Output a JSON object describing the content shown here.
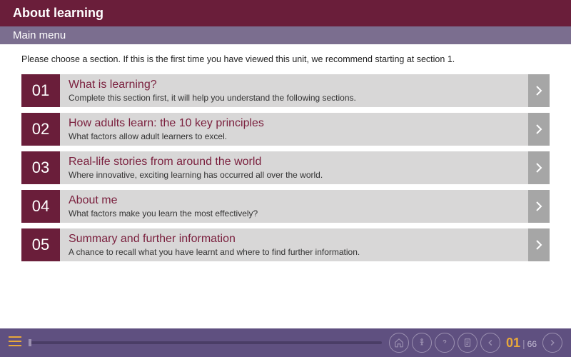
{
  "header": {
    "title": "About learning",
    "subtitle": "Main menu"
  },
  "instruction": "Please choose a section. If this is the first time you have viewed this unit, we recommend starting at section 1.",
  "sections": [
    {
      "num": "01",
      "title": "What is learning?",
      "desc": "Complete this section first, it will help you understand the following sections."
    },
    {
      "num": "02",
      "title": "How adults learn: the 10 key principles",
      "desc": "What factors allow adult learners to excel."
    },
    {
      "num": "03",
      "title": "Real-life stories from around the world",
      "desc": "Where innovative, exciting learning has occurred all over the world."
    },
    {
      "num": "04",
      "title": "About me",
      "desc": "What factors make you learn the most effectively?"
    },
    {
      "num": "05",
      "title": "Summary and further information",
      "desc": "A chance to recall what you have learnt and where to find further information."
    }
  ],
  "footer": {
    "current_page": "01",
    "total_pages": "66"
  }
}
